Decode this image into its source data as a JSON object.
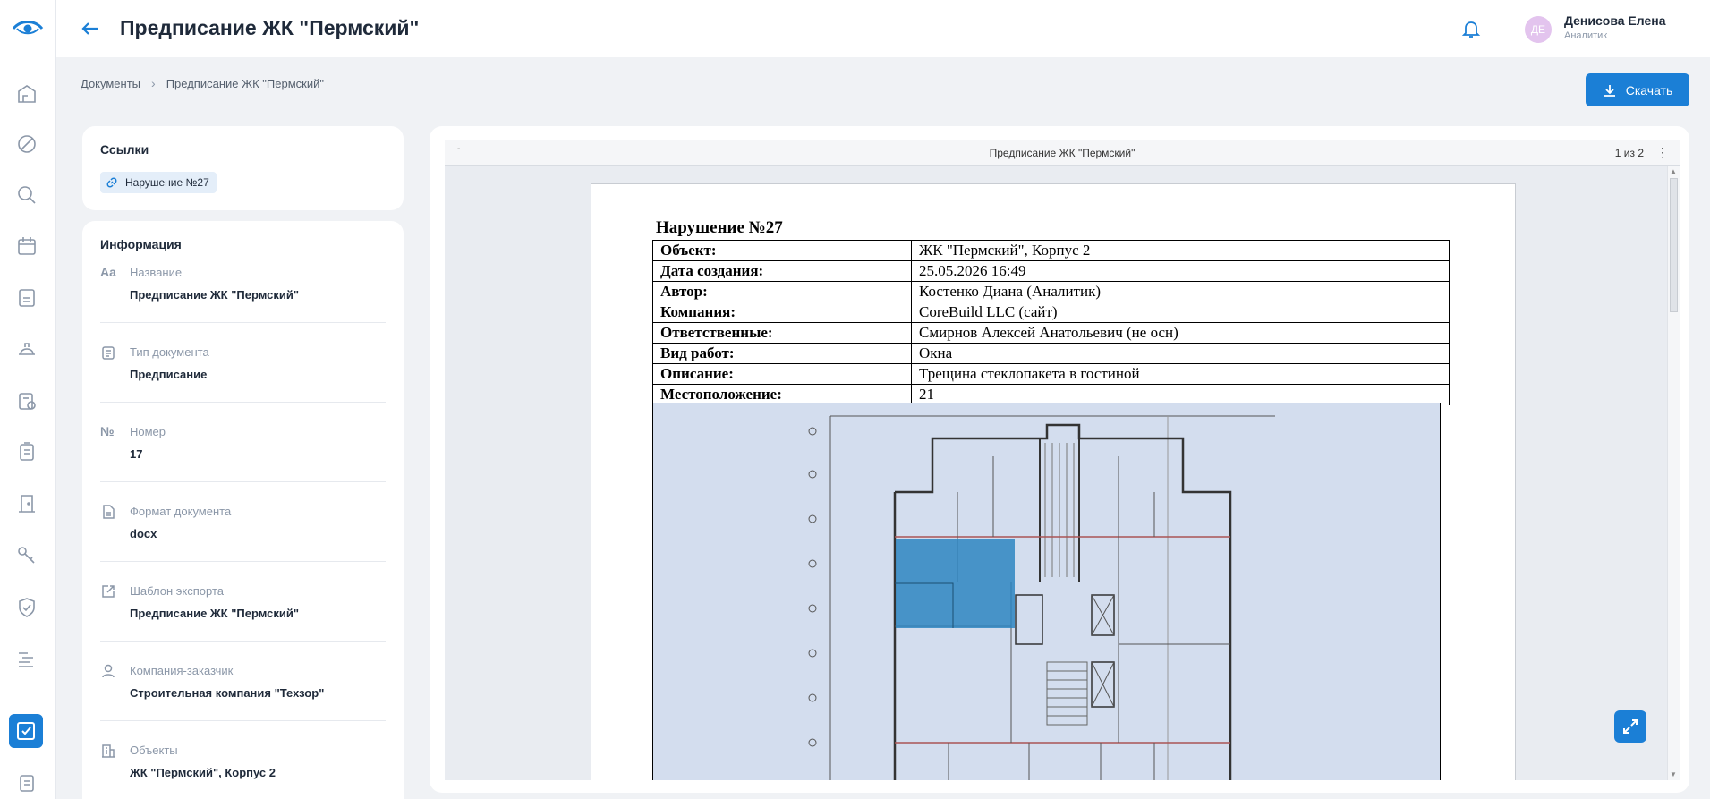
{
  "header": {
    "title": "Предписание ЖК \"Пермский\"",
    "user": {
      "initials": "ДЕ",
      "name": "Денисова Елена",
      "role": "Аналитик"
    }
  },
  "breadcrumb": {
    "root": "Документы",
    "current": "Предписание ЖК \"Пермский\""
  },
  "actions": {
    "download_label": "Скачать"
  },
  "links_card": {
    "title": "Ссылки",
    "chip": "Нарушение №27"
  },
  "info_card": {
    "title": "Информация",
    "items": [
      {
        "icon": "text-aa-icon",
        "label": "Название",
        "value": "Предписание ЖК \"Пермский\""
      },
      {
        "icon": "clipboard-icon",
        "label": "Тип документа",
        "value": "Предписание"
      },
      {
        "icon": "number-sign-icon",
        "label": "Номер",
        "value": "17"
      },
      {
        "icon": "file-icon",
        "label": "Формат документа",
        "value": "docx"
      },
      {
        "icon": "export-icon",
        "label": "Шаблон экспорта",
        "value": "Предписание ЖК \"Пермский\""
      },
      {
        "icon": "user-icon",
        "label": "Компания-заказчик",
        "value": "Строительная компания \"Техзор\""
      },
      {
        "icon": "building-icon",
        "label": "Объекты",
        "value": "ЖК \"Пермский\", Корпус 2"
      }
    ]
  },
  "viewer": {
    "title": "Предписание ЖК \"Пермский\"",
    "pages": "1 из 2",
    "document": {
      "heading": "Нарушение №27",
      "rows": [
        {
          "key": "Объект:",
          "value": "ЖК \"Пермский\", Корпус 2"
        },
        {
          "key": "Дата создания:",
          "value": "25.05.2026 16:49"
        },
        {
          "key": "Автор:",
          "value": "Костенко Диана (Аналитик)"
        },
        {
          "key": "Компания:",
          "value": "CoreBuild LLC (сайт)"
        },
        {
          "key": "Ответственные:",
          "value": "Смирнов Алексей Анатольевич (не осн)"
        },
        {
          "key": "Вид работ:",
          "value": "Окна"
        },
        {
          "key": "Описание:",
          "value": "Трещина стеклопакета в гостиной"
        },
        {
          "key": "Местоположение:",
          "value": "21"
        }
      ]
    }
  },
  "colors": {
    "accent": "#1b7fd6",
    "background": "#f0f2f5",
    "highlight": "#2e86c1"
  }
}
